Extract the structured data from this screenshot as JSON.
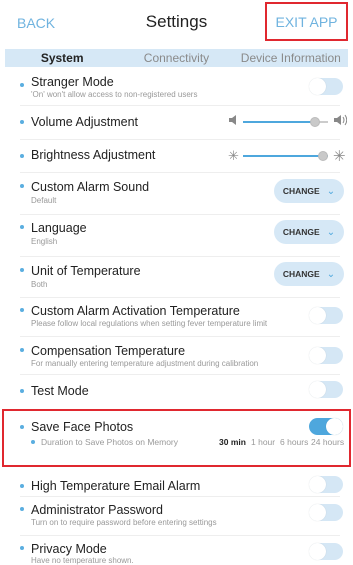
{
  "header": {
    "back_label": "BACK",
    "title": "Settings",
    "exit_label": "EXIT APP"
  },
  "tabs": [
    {
      "label": "System",
      "active": true
    },
    {
      "label": "Connectivity",
      "active": false
    },
    {
      "label": "Device Information",
      "active": false
    }
  ],
  "settings": {
    "stranger_mode": {
      "label": "Stranger Mode",
      "sub": "'On' won't allow access to non-registered users",
      "enabled": false
    },
    "volume": {
      "label": "Volume Adjustment",
      "level": 0.85
    },
    "brightness": {
      "label": "Brightness Adjustment",
      "level": 1.0
    },
    "alarm_sound": {
      "label": "Custom Alarm Sound",
      "sub": "Default",
      "button": "CHANGE"
    },
    "language": {
      "label": "Language",
      "sub": "English",
      "button": "CHANGE"
    },
    "temp_unit": {
      "label": "Unit of Temperature",
      "sub": "Both",
      "button": "CHANGE"
    },
    "alarm_activation": {
      "label": "Custom Alarm Activation Temperature",
      "sub": "Please follow local regulations when setting fever temperature limit",
      "enabled": false
    },
    "compensation": {
      "label": "Compensation Temperature",
      "sub": "For manually entering temperature adjustment during calibration",
      "enabled": false
    },
    "test_mode": {
      "label": "Test Mode",
      "enabled": false
    },
    "save_face": {
      "label": "Save Face Photos",
      "enabled": true,
      "duration_label": "Duration to Save Photos on Memory",
      "options": [
        "30 min",
        "1 hour",
        "6 hours",
        "24 hours"
      ],
      "selected": "30 min"
    },
    "email_alarm": {
      "label": "High Temperature Email Alarm",
      "enabled": false
    },
    "admin_password": {
      "label": "Administrator Password",
      "sub": "Turn on to require password before entering settings",
      "enabled": false
    },
    "privacy_mode": {
      "label": "Privacy Mode",
      "sub": "Have no temperature shown.",
      "enabled": false
    }
  },
  "icons": {
    "volume_low": "speaker-low-icon",
    "volume_high": "speaker-high-icon",
    "brightness_low": "sun-low-icon",
    "brightness_high": "sun-high-icon",
    "chevron": "chevron-down-icon"
  },
  "colors": {
    "accent": "#4ea7dd",
    "tab_bg": "#d6e8f6",
    "highlight": "#e0282f"
  }
}
